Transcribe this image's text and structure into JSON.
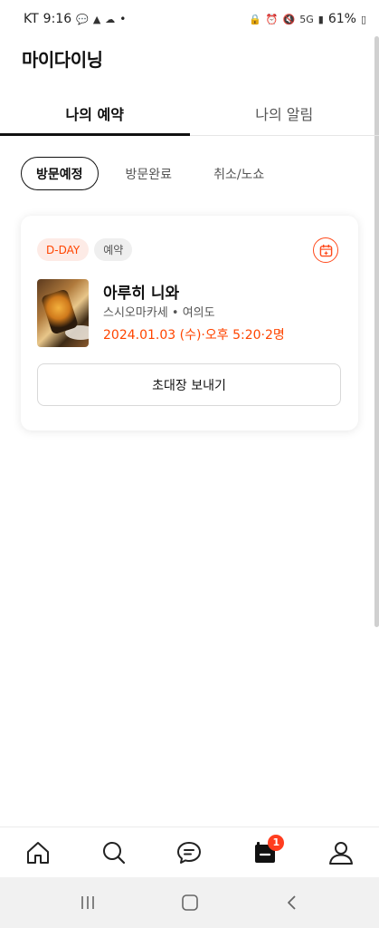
{
  "status_bar": {
    "carrier": "KT",
    "time": "9:16",
    "dot": "•",
    "network": "5G",
    "battery": "61%"
  },
  "header": {
    "title": "마이다이닝"
  },
  "tabs": [
    {
      "label": "나의 예약",
      "active": true
    },
    {
      "label": "나의 알림",
      "active": false
    }
  ],
  "filters": [
    {
      "label": "방문예정",
      "active": true
    },
    {
      "label": "방문완료",
      "active": false
    },
    {
      "label": "취소/노쇼",
      "active": false
    }
  ],
  "reservation": {
    "dday": "D-DAY",
    "status": "예약",
    "name": "아루히 니와",
    "subtitle": "스시오마카세 • 여의도",
    "datetime": "2024.01.03 (수)·오후 5:20·2명",
    "invite_label": "초대장 보내기"
  },
  "bottom_nav": {
    "items": [
      "home-icon",
      "search-icon",
      "chat-icon",
      "reservation-icon",
      "profile-icon"
    ],
    "reservation_badge": "1"
  },
  "colors": {
    "accent": "#ff4500",
    "badge_bg": "#fdebe6"
  }
}
